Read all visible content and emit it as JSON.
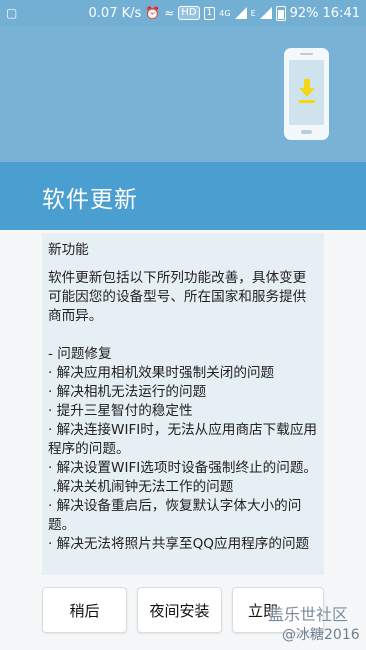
{
  "status_bar": {
    "network_speed": "0.07 K/s",
    "hd_label": "HD",
    "sim_label": "1",
    "network_type": "4G",
    "carrier_type": "E",
    "battery": "92%",
    "time": "16:41"
  },
  "header": {
    "title": "软件更新"
  },
  "notes": {
    "heading": "新功能",
    "intro": "软件更新包括以下所列功能改善，具体变更可能因您的设备型号、所在国家和服务提供商而异。",
    "section_title": "- 问题修复",
    "items": [
      "· 解决应用相机效果时强制关闭的问题",
      "· 解决相机无法运行的问题",
      "· 提升三星智付的稳定性",
      "· 解决连接WIFI时，无法从应用商店下载应用程序的问题。",
      "· 解决设置WIFI选项时设备强制终止的问题。",
      " .解决关机闹钟无法工作的问题",
      "· 解决设备重启后，恢复默认字体大小的问题。",
      "· 解决无法将照片共享至QQ应用程序的问题"
    ]
  },
  "buttons": {
    "later": "稍后",
    "night_install": "夜间安装",
    "install_now": "立即"
  },
  "watermark": {
    "site": "盖乐世社区",
    "user": "@冰糖2016"
  },
  "colors": {
    "status_bar": "#73afd3",
    "hero": "#78b3d5",
    "title_band": "#4a9ed0",
    "notes_bg": "#e6eff3",
    "download_arrow": "#f3d615"
  }
}
